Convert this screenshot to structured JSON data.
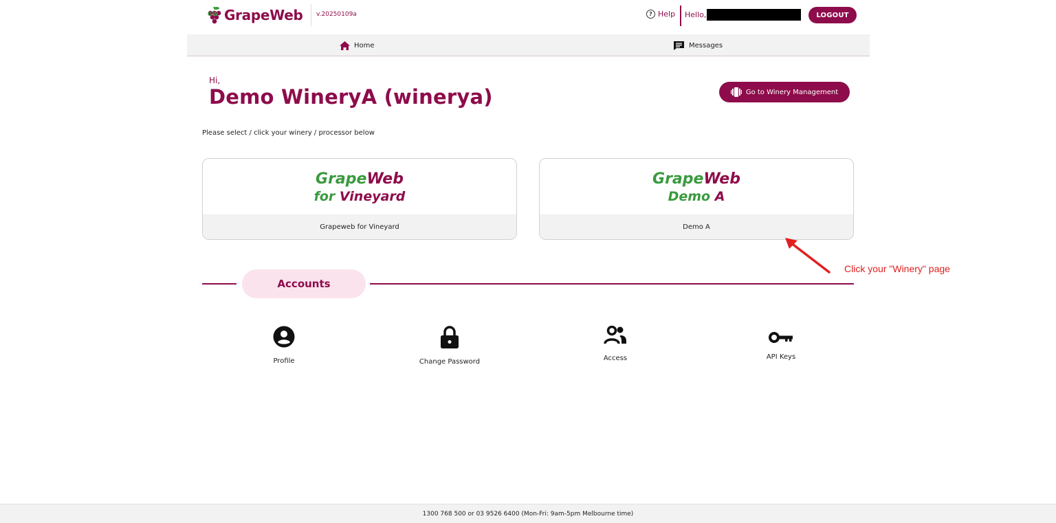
{
  "header": {
    "logo_text": "GrapeWeb",
    "version": "v.20250109a",
    "help_label": "Help",
    "hello_label": "Hello,",
    "logout_label": "LOGOUT"
  },
  "nav": {
    "items": [
      {
        "label": "Home",
        "icon": "home-icon"
      },
      {
        "label": "Messages",
        "icon": "message-icon"
      }
    ]
  },
  "main": {
    "greeting": "Hi,",
    "title": "Demo WineryA (winerya)",
    "goto_label": "Go to Winery Management",
    "instruction": "Please select / click your winery / processor below"
  },
  "cards": [
    {
      "logo_line1_green": "Grape",
      "logo_line1_red": "Web",
      "logo_line2_green": "for ",
      "logo_line2_red": "Vineyard",
      "label": "Grapeweb for Vineyard"
    },
    {
      "logo_line1_green": "Grape",
      "logo_line1_red": "Web",
      "logo_line2_green": "Demo ",
      "logo_line2_red": "A",
      "label": "Demo A"
    }
  ],
  "annotation": {
    "text": "Click your \"Winery\" page",
    "color": "#e02020"
  },
  "accounts": {
    "section_title": "Accounts",
    "items": [
      {
        "label": "Profile",
        "icon": "profile-icon"
      },
      {
        "label": "Change Password",
        "icon": "lock-icon"
      },
      {
        "label": "Access",
        "icon": "users-icon"
      },
      {
        "label": "API Keys",
        "icon": "key-icon"
      }
    ]
  },
  "footer": {
    "text": "1300 768 500 or 03 9526 6400 (Mon-Fri: 9am-5pm Melbourne time)"
  },
  "colors": {
    "brand": "#8e0c4b",
    "green": "#3a9a3e",
    "pill_bg": "#fbe3ee"
  }
}
